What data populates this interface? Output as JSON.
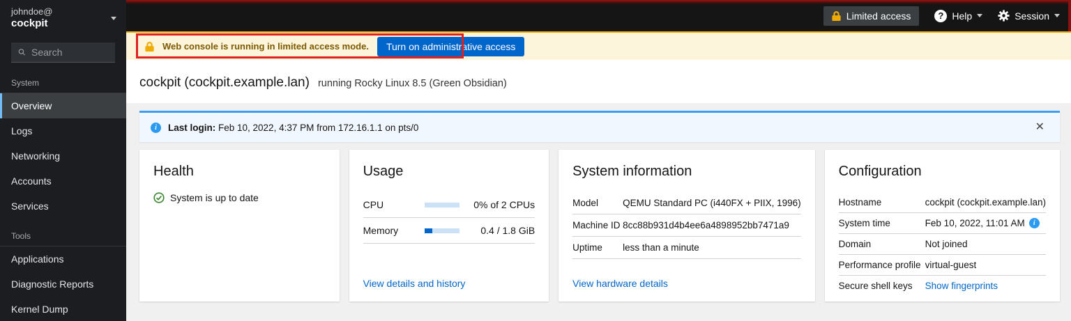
{
  "sidebar": {
    "user_line1": "johndoe@",
    "user_line2": "cockpit",
    "search_placeholder": "Search",
    "sections": [
      {
        "label": "System",
        "items": [
          {
            "label": "Overview",
            "selected": true
          },
          {
            "label": "Logs"
          },
          {
            "label": "Networking"
          },
          {
            "label": "Accounts"
          },
          {
            "label": "Services"
          }
        ]
      },
      {
        "label": "Tools",
        "items": [
          {
            "label": "Applications"
          },
          {
            "label": "Diagnostic Reports"
          },
          {
            "label": "Kernel Dump"
          }
        ]
      }
    ]
  },
  "masthead": {
    "limited_access": "Limited access",
    "help": "Help",
    "session": "Session"
  },
  "banner": {
    "message": "Web console is running in limited access mode.",
    "button": "Turn on administrative access"
  },
  "page": {
    "title": "cockpit (cockpit.example.lan)",
    "subtitle": "running Rocky Linux 8.5 (Green Obsidian)"
  },
  "alert": {
    "label": "Last login:",
    "text": " Feb 10, 2022, 4:37 PM from 172.16.1.1 on pts/0"
  },
  "icons": {
    "help": "?",
    "info": "i",
    "close": "✕"
  },
  "cards": {
    "health": {
      "title": "Health",
      "status": "System is up to date"
    },
    "usage": {
      "title": "Usage",
      "rows": [
        {
          "label": "CPU",
          "value": "0% of 2 CPUs",
          "percent": 0
        },
        {
          "label": "Memory",
          "value": "0.4 / 1.8 GiB",
          "percent": 22
        }
      ],
      "link": "View details and history"
    },
    "system_information": {
      "title": "System information",
      "rows": [
        {
          "key": "Model",
          "value": "QEMU Standard PC (i440FX + PIIX, 1996)"
        },
        {
          "key": "Machine ID",
          "value": "8cc88b931d4b4ee6a4898952bb7471a9"
        },
        {
          "key": "Uptime",
          "value": "less than a minute"
        }
      ],
      "link": "View hardware details"
    },
    "configuration": {
      "title": "Configuration",
      "rows": [
        {
          "key": "Hostname",
          "value": "cockpit (cockpit.example.lan)"
        },
        {
          "key": "System time",
          "value": "Feb 10, 2022, 11:01 AM"
        },
        {
          "key": "Domain",
          "value": "Not joined"
        },
        {
          "key": "Performance profile",
          "value": "virtual-guest"
        },
        {
          "key": "Secure shell keys",
          "value": "Show fingerprints"
        }
      ]
    }
  },
  "colors": {
    "accent_blue": "#0066cc",
    "gold": "#f0ab00",
    "info_blue": "#2b9af3",
    "success_green": "#3e8635",
    "annotation_red": "#e01f1f"
  }
}
